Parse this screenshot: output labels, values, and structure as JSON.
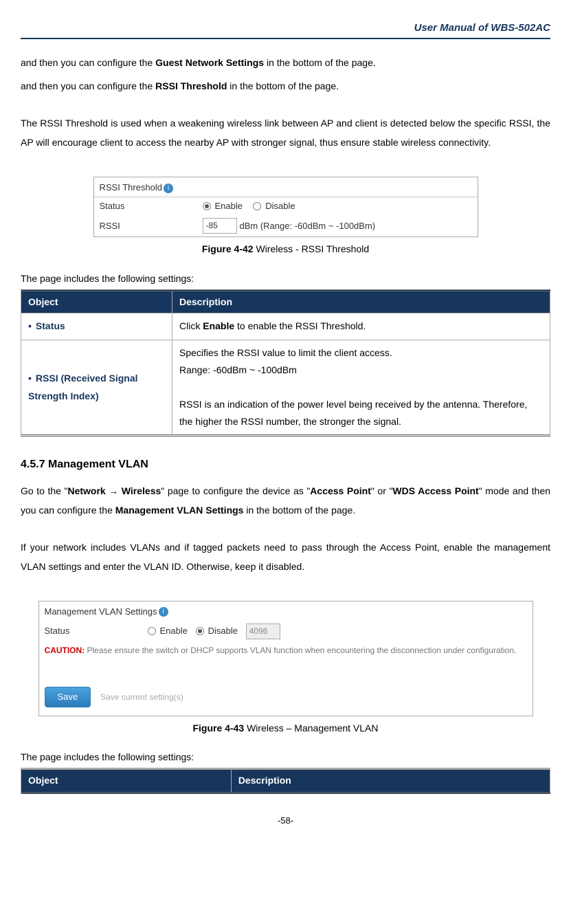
{
  "header": {
    "title": "User Manual of WBS-502AC"
  },
  "intro": {
    "line1_pre": "and then you can configure the ",
    "line1_bold": "Guest Network Settings",
    "line1_post": " in the bottom of the page.",
    "line2_pre": "and then you can configure the ",
    "line2_bold": "RSSI Threshold",
    "line2_post": " in the bottom of the page.",
    "rssi_para": "The RSSI Threshold is used when a weakening wireless link between AP and client is detected below the specific RSSI, the AP will encourage client to access the nearby AP with stronger signal, thus ensure stable wireless connectivity."
  },
  "fig42": {
    "title": "RSSI Threshold",
    "status_label": "Status",
    "enable": "Enable",
    "disable": "Disable",
    "rssi_label": "RSSI",
    "rssi_value": "-85",
    "rssi_hint": "dBm (Range: -60dBm ~ -100dBm)",
    "caption_bold": "Figure 4-42",
    "caption_rest": " Wireless - RSSI Threshold"
  },
  "table_intro": "The page includes the following settings:",
  "table1": {
    "col1": "Object",
    "col2": "Description",
    "r1_obj": "Status",
    "r1_desc_pre": "Click ",
    "r1_desc_bold": "Enable",
    "r1_desc_post": " to enable the RSSI Threshold.",
    "r2_obj": "RSSI (Received Signal Strength Index)",
    "r2_desc": "Specifies the RSSI value to limit the client access.\nRange: -60dBm ~ -100dBm\n\nRSSI is an indication of the power level being received by the antenna. Therefore, the higher the RSSI number, the stronger the signal."
  },
  "section457": {
    "heading": "4.5.7   Management VLAN",
    "p1_pre": "Go to the \"",
    "p1_b1": "Network ",
    "p1_arrow": "→",
    "p1_b2": " Wireless",
    "p1_mid": "\" page to configure the device as \"",
    "p1_b3": "Access Point",
    "p1_mid2": "\" or \"",
    "p1_b4": "WDS Access Point",
    "p1_mid3": "\" mode and then you can configure the ",
    "p1_b5": "Management VLAN Settings",
    "p1_post": " in the bottom of the page.",
    "p2": "If your network includes VLANs and if tagged packets need to pass through the Access Point, enable the management VLAN settings and enter the VLAN ID. Otherwise, keep it disabled."
  },
  "fig43": {
    "title": "Management VLAN Settings",
    "status_label": "Status",
    "enable": "Enable",
    "disable": "Disable",
    "vlan_value": "4096",
    "caution_label": "CAUTION:",
    "caution_text": "Please ensure the switch or DHCP supports VLAN function when encountering the disconnection under configuration.",
    "save": "Save",
    "save_hint": "Save current setting(s)",
    "caption_bold": "Figure 4-43",
    "caption_rest": " Wireless – Management VLAN"
  },
  "table2": {
    "col1": "Object",
    "col2": "Description"
  },
  "footer": {
    "page": "-58-"
  }
}
